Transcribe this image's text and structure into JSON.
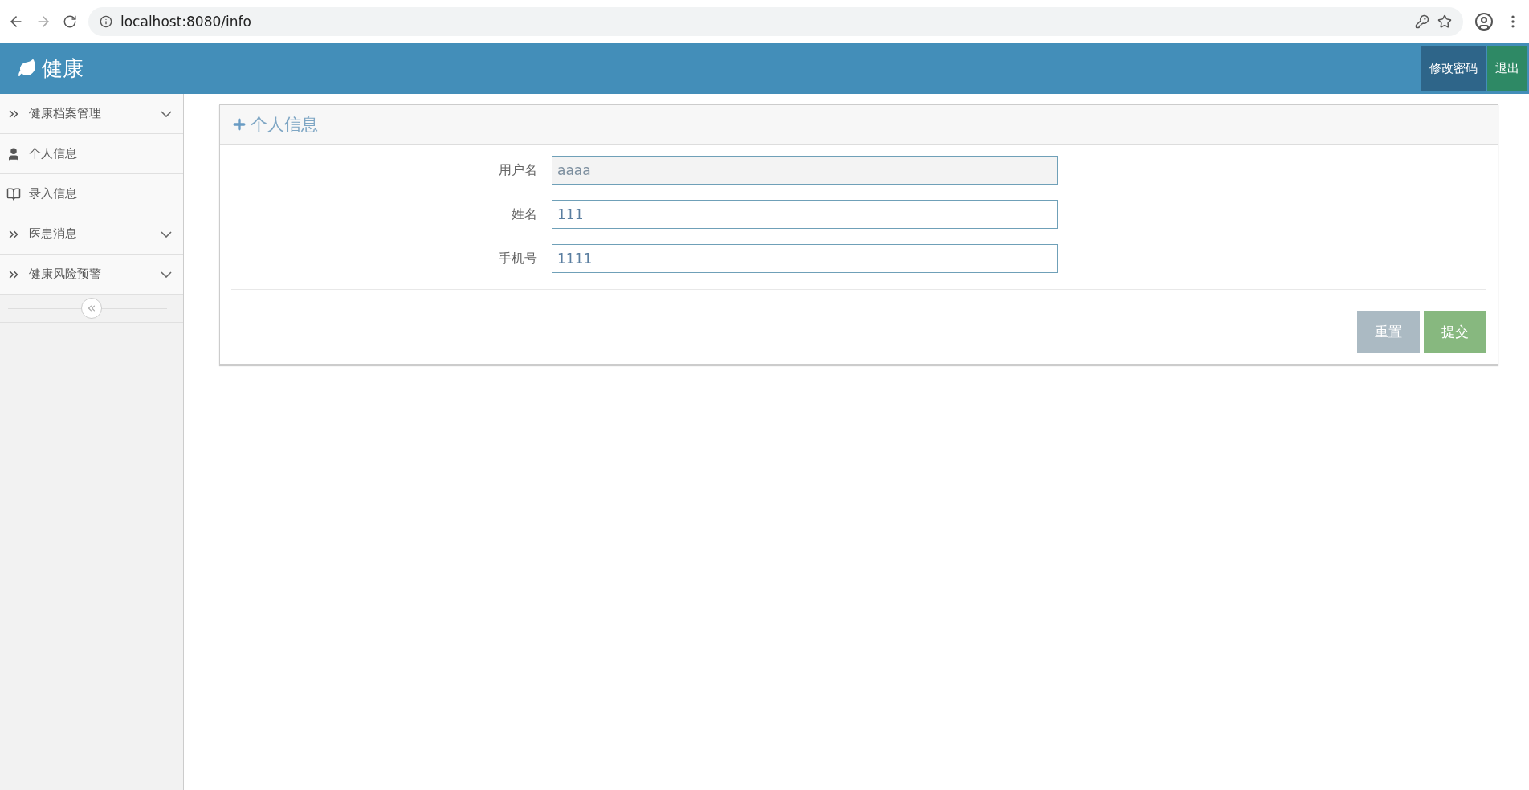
{
  "browser": {
    "url": "localhost:8080/info"
  },
  "header": {
    "title": "健康",
    "buttons": [
      {
        "label": "修改密码",
        "kind": "primary"
      },
      {
        "label": "退出",
        "kind": "success"
      }
    ]
  },
  "sidebar": {
    "items": [
      {
        "label": "健康档案管理",
        "kind": "menu",
        "expanded": false
      },
      {
        "label": "个人信息",
        "kind": "link"
      },
      {
        "label": "录入信息",
        "kind": "link"
      },
      {
        "label": "医患消息",
        "kind": "menu",
        "expanded": false
      },
      {
        "label": "健康风险预警",
        "kind": "menu",
        "expanded": false
      }
    ]
  },
  "panel": {
    "title": "个人信息",
    "fields": [
      {
        "label": "用户名",
        "value": "aaaa",
        "disabled": true
      },
      {
        "label": "姓名",
        "value": "111",
        "disabled": false
      },
      {
        "label": "手机号",
        "value": "1111",
        "disabled": false
      }
    ],
    "buttons": [
      {
        "label": "重置",
        "kind": "reset"
      },
      {
        "label": "提交",
        "kind": "submit"
      }
    ]
  }
}
